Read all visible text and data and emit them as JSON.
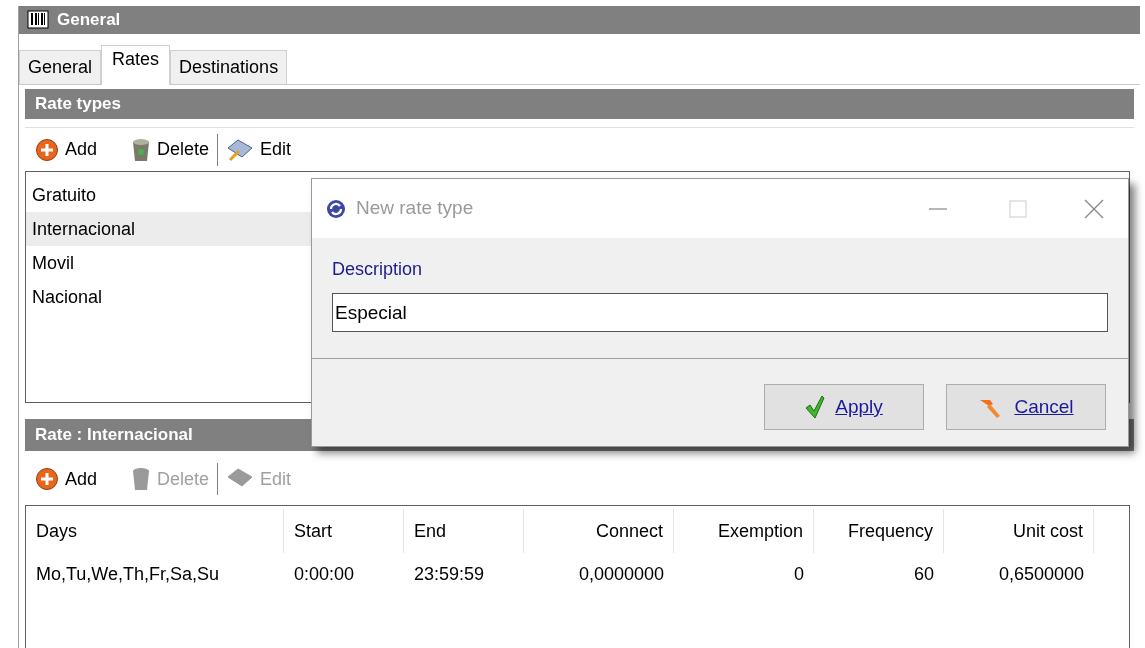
{
  "window": {
    "title": "General"
  },
  "tabs": [
    {
      "label": "General",
      "selected": false
    },
    {
      "label": "Rates",
      "selected": true
    },
    {
      "label": "Destinations",
      "selected": false
    }
  ],
  "rate_types": {
    "title": "Rate types",
    "toolbar": [
      {
        "kind": "add",
        "label": "Add",
        "disabled": false
      },
      {
        "kind": "delete",
        "label": "Delete",
        "disabled": false
      },
      {
        "kind": "edit",
        "label": "Edit",
        "disabled": false
      }
    ],
    "items": [
      {
        "label": "Gratuito",
        "selected": false
      },
      {
        "label": "Internacional",
        "selected": true
      },
      {
        "label": "Movil",
        "selected": false
      },
      {
        "label": "Nacional",
        "selected": false
      }
    ]
  },
  "rate": {
    "title": "Rate : Internacional",
    "toolbar": [
      {
        "kind": "add",
        "label": "Add",
        "disabled": false
      },
      {
        "kind": "delete",
        "label": "Delete",
        "disabled": true
      },
      {
        "kind": "edit",
        "label": "Edit",
        "disabled": true
      }
    ],
    "table": {
      "columns": [
        {
          "label": "Days",
          "kind": "text"
        },
        {
          "label": "Start",
          "kind": "text"
        },
        {
          "label": "End",
          "kind": "text"
        },
        {
          "label": "Connect",
          "kind": "number"
        },
        {
          "label": "Exemption",
          "kind": "number"
        },
        {
          "label": "Frequency",
          "kind": "number"
        },
        {
          "label": "Unit cost",
          "kind": "number"
        }
      ],
      "rows": [
        [
          "Mo,Tu,We,Th,Fr,Sa,Su",
          "0:00:00",
          "23:59:59",
          "0,0000000",
          "0",
          "60",
          "0,6500000"
        ]
      ]
    }
  },
  "dialog": {
    "title": "New rate type",
    "field_label": "Description",
    "field_value": "Especial",
    "buttons": [
      {
        "kind": "apply",
        "label": "Apply"
      },
      {
        "kind": "cancel",
        "label": "Cancel"
      }
    ]
  }
}
